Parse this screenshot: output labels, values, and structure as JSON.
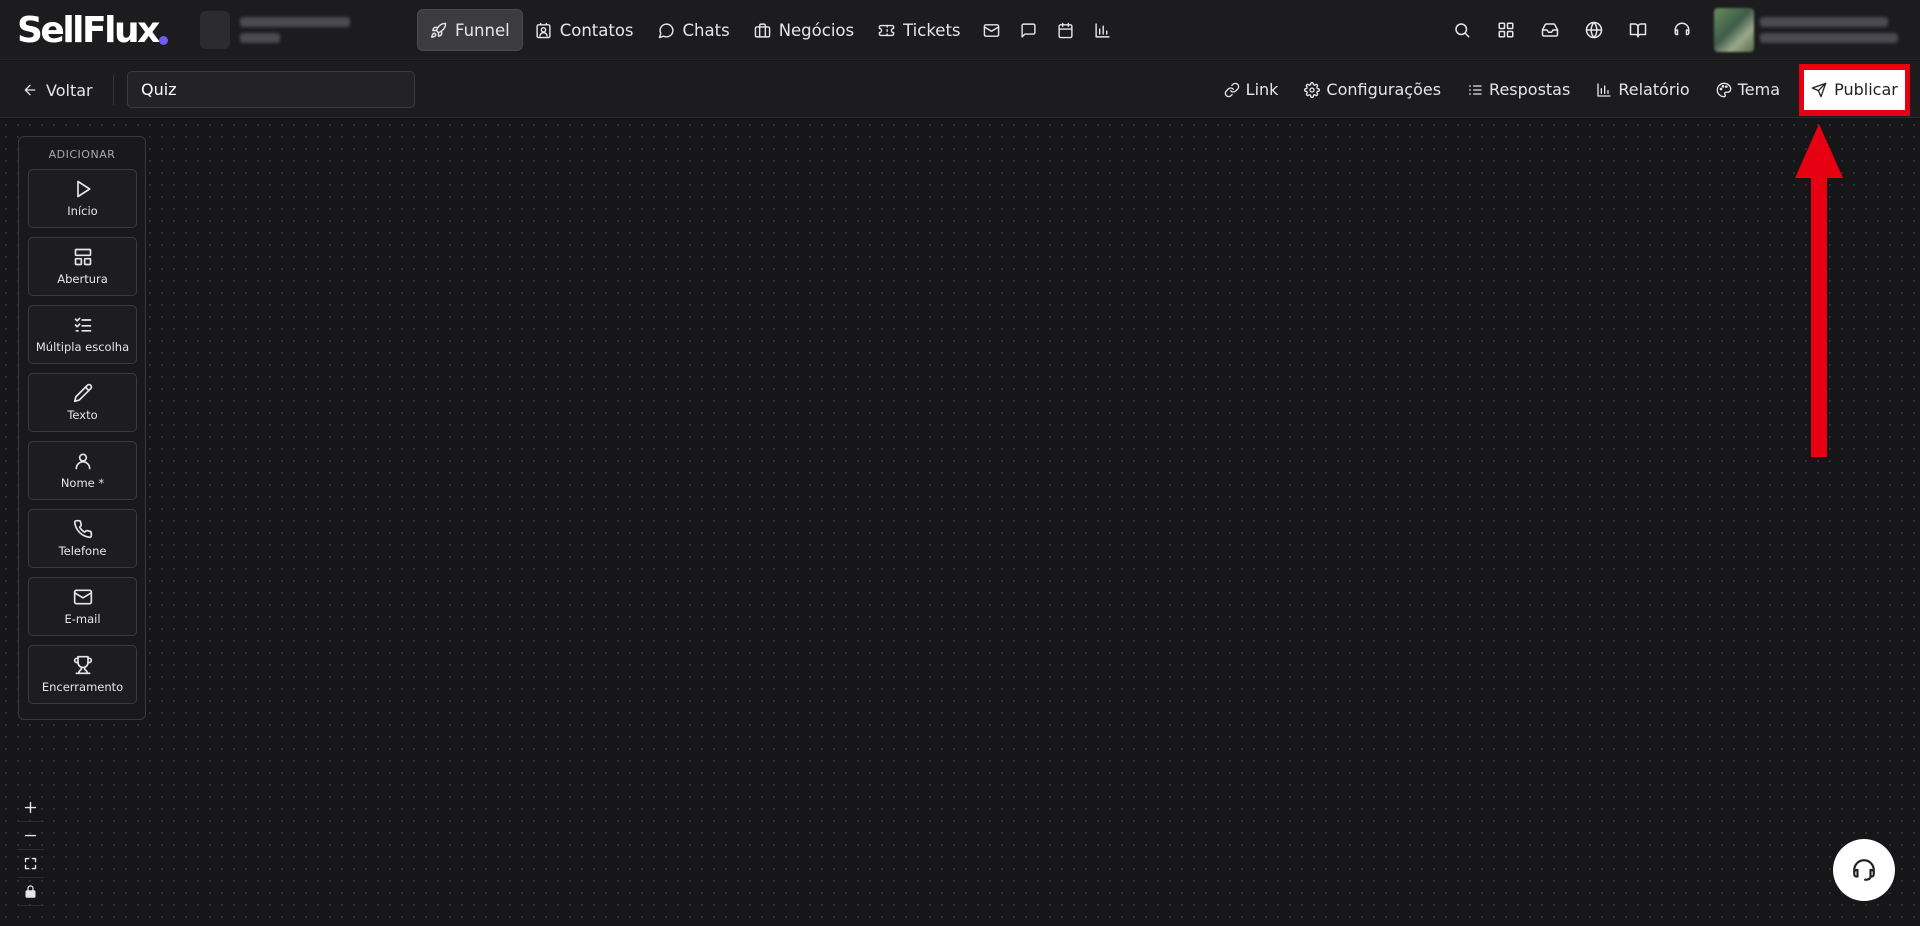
{
  "app": {
    "logo_text": "SellFlux"
  },
  "nav": {
    "items": [
      {
        "label": "Funnel",
        "icon": "rocket-icon",
        "active": true
      },
      {
        "label": "Contatos",
        "icon": "contacts-icon"
      },
      {
        "label": "Chats",
        "icon": "chat-bubble-icon"
      },
      {
        "label": "Negócios",
        "icon": "briefcase-icon"
      },
      {
        "label": "Tickets",
        "icon": "ticket-icon"
      }
    ],
    "icon_items": [
      "mail-icon",
      "message-square-icon",
      "calendar-icon",
      "bar-chart-icon"
    ],
    "right_icons": [
      "search-icon",
      "apps-grid-icon",
      "inbox-icon",
      "globe-icon",
      "book-icon",
      "headset-icon"
    ]
  },
  "toolbar": {
    "back_label": "Voltar",
    "title_value": "Quiz",
    "actions": [
      {
        "label": "Link",
        "icon": "link-icon"
      },
      {
        "label": "Configurações",
        "icon": "gear-icon"
      },
      {
        "label": "Respostas",
        "icon": "list-icon"
      },
      {
        "label": "Relatório",
        "icon": "bar-chart-icon"
      },
      {
        "label": "Tema",
        "icon": "palette-icon"
      }
    ],
    "publish_label": "Publicar"
  },
  "palette": {
    "title": "ADICIONAR",
    "blocks": [
      {
        "label": "Início",
        "icon": "play-icon"
      },
      {
        "label": "Abertura",
        "icon": "layout-icon"
      },
      {
        "label": "Múltipla escolha",
        "icon": "checklist-icon"
      },
      {
        "label": "Texto",
        "icon": "pencil-icon"
      },
      {
        "label": "Nome *",
        "icon": "user-icon"
      },
      {
        "label": "Telefone",
        "icon": "phone-icon"
      },
      {
        "label": "E-mail",
        "icon": "mail-icon"
      },
      {
        "label": "Encerramento",
        "icon": "trophy-icon"
      }
    ]
  },
  "colors": {
    "highlight": "#e60012",
    "background": "#161618",
    "accent": "#6d5cf2"
  }
}
